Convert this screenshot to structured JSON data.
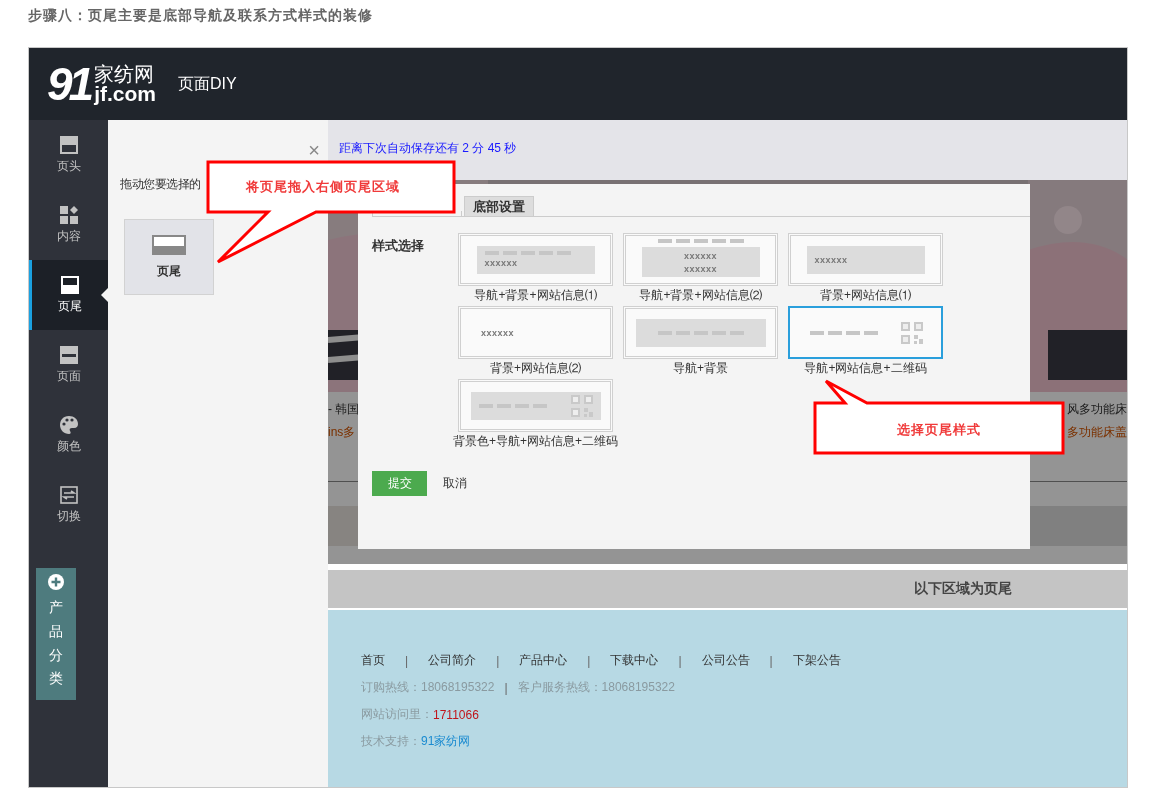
{
  "heading": "步骤八：页尾主要是底部导航及联系方式样式的装修",
  "app": {
    "logo": {
      "number": "91",
      "name": "家纺网",
      "domain": "jf.com"
    },
    "title": "页面DIY"
  },
  "sidebar": {
    "items": [
      {
        "label": "页头",
        "kind": "header",
        "selected": false
      },
      {
        "label": "内容",
        "kind": "content",
        "selected": false
      },
      {
        "label": "页尾",
        "kind": "footer",
        "selected": true
      },
      {
        "label": "页面",
        "kind": "page",
        "selected": false
      },
      {
        "label": "颜色",
        "kind": "palette",
        "selected": false
      },
      {
        "label": "切换",
        "kind": "switch",
        "selected": false
      }
    ],
    "category_button": {
      "label": "产品分类"
    }
  },
  "module_panel": {
    "close": "×",
    "instruction": "拖动您要选择的",
    "modules": [
      {
        "label": "页尾"
      }
    ]
  },
  "autosave": {
    "text": "距离下次自动保存还有 2 分 45 秒"
  },
  "background_products": {
    "rows": [
      {
        "kind": "title",
        "left": "- 韩国",
        "right": "风多功能床"
      },
      {
        "kind": "promo",
        "left": "ins多",
        "right": "多功能床盖"
      }
    ]
  },
  "style_dialog": {
    "tabs": [
      {
        "selected": true
      },
      {
        "label": "底部设置",
        "selected": false
      }
    ],
    "field_label": "样式选择",
    "options": [
      {
        "label": "导航+背景+网站信息⑴",
        "kind": "nav_bg_info",
        "samples": [
          "xxxxxx"
        ],
        "selected": false
      },
      {
        "label": "导航+背景+网站信息⑵",
        "kind": "nav_above_bg",
        "samples": [
          "xxxxxx",
          "xxxxxx"
        ],
        "selected": false
      },
      {
        "label": "背景+网站信息⑴",
        "kind": "bg_info",
        "samples": [
          "xxxxxx"
        ],
        "selected": false
      },
      {
        "label": "背景+网站信息⑵",
        "kind": "info",
        "samples": [
          "xxxxxx"
        ],
        "selected": false
      },
      {
        "label": "导航+背景",
        "kind": "nav_bg",
        "selected": false
      },
      {
        "label": "导航+网站信息+二维码",
        "kind": "nav_qr",
        "selected": true
      },
      {
        "label": "背景色+导航+网站信息+二维码",
        "kind": "bg_nav_qr",
        "selected": false
      }
    ],
    "buttons": [
      {
        "label": "提交",
        "kind": "primary"
      },
      {
        "label": "取消",
        "kind": "plain"
      }
    ]
  },
  "footer_marker": "以下区域为页尾",
  "footer": {
    "separator": "|",
    "nav": [
      "首页",
      "公司简介",
      "产品中心",
      "下载中心",
      "公司公告",
      "下架公告"
    ],
    "hotlines": [
      "订购热线：18068195322",
      "客户服务热线：18068195322"
    ],
    "visits": {
      "label": "网站访问里：",
      "value": "1711066"
    },
    "support": {
      "label": "技术支持：",
      "link": "91家纺网"
    }
  },
  "callouts": [
    {
      "text": "将页尾拖入右侧页尾区域",
      "kind": "left"
    },
    {
      "text": "选择页尾样式",
      "kind": "up"
    }
  ]
}
